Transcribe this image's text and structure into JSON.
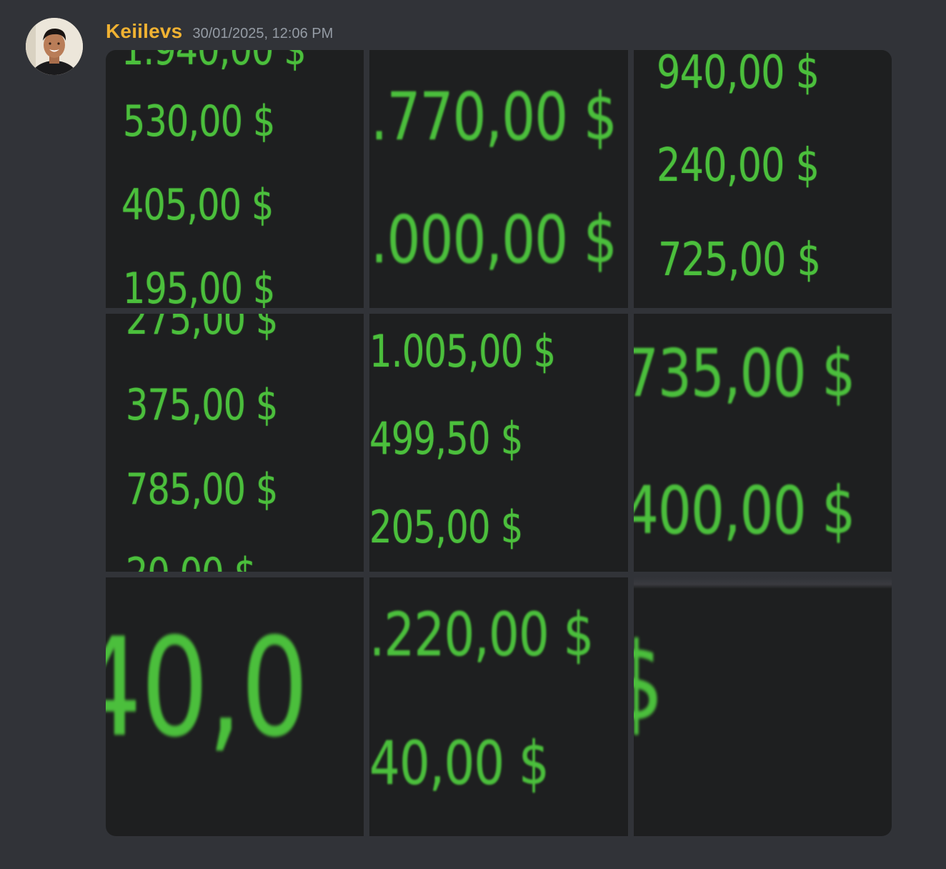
{
  "message": {
    "username": "Keiilevs",
    "timestamp": "30/01/2025, 12:06 PM"
  },
  "colors": {
    "background": "#313338",
    "username": "#f0b232",
    "timestamp": "#949ba4",
    "tile_background": "#1e1f20",
    "amount_green": "#4bbf3c"
  },
  "gallery": {
    "tiles": [
      {
        "lines": [
          "530,00 $",
          "405,00 $",
          "195,00 $"
        ]
      },
      {
        "lines": [
          ".770,00 $",
          ".000,00 $"
        ]
      },
      {
        "lines": [
          "940,00 $",
          "240,00 $",
          "725,00 $"
        ]
      },
      {
        "lines": [
          "375,00 $",
          "785,00 $"
        ]
      },
      {
        "lines": [
          "1.005,00 $",
          "499,50 $",
          "205,00 $"
        ]
      },
      {
        "lines": [
          "735,00 $",
          "400,00 $"
        ]
      },
      {
        "lines": [
          "40,0"
        ]
      },
      {
        "lines": [
          ".220,00 $",
          "40,00 $"
        ]
      },
      {
        "lines": [
          "$"
        ]
      }
    ]
  }
}
